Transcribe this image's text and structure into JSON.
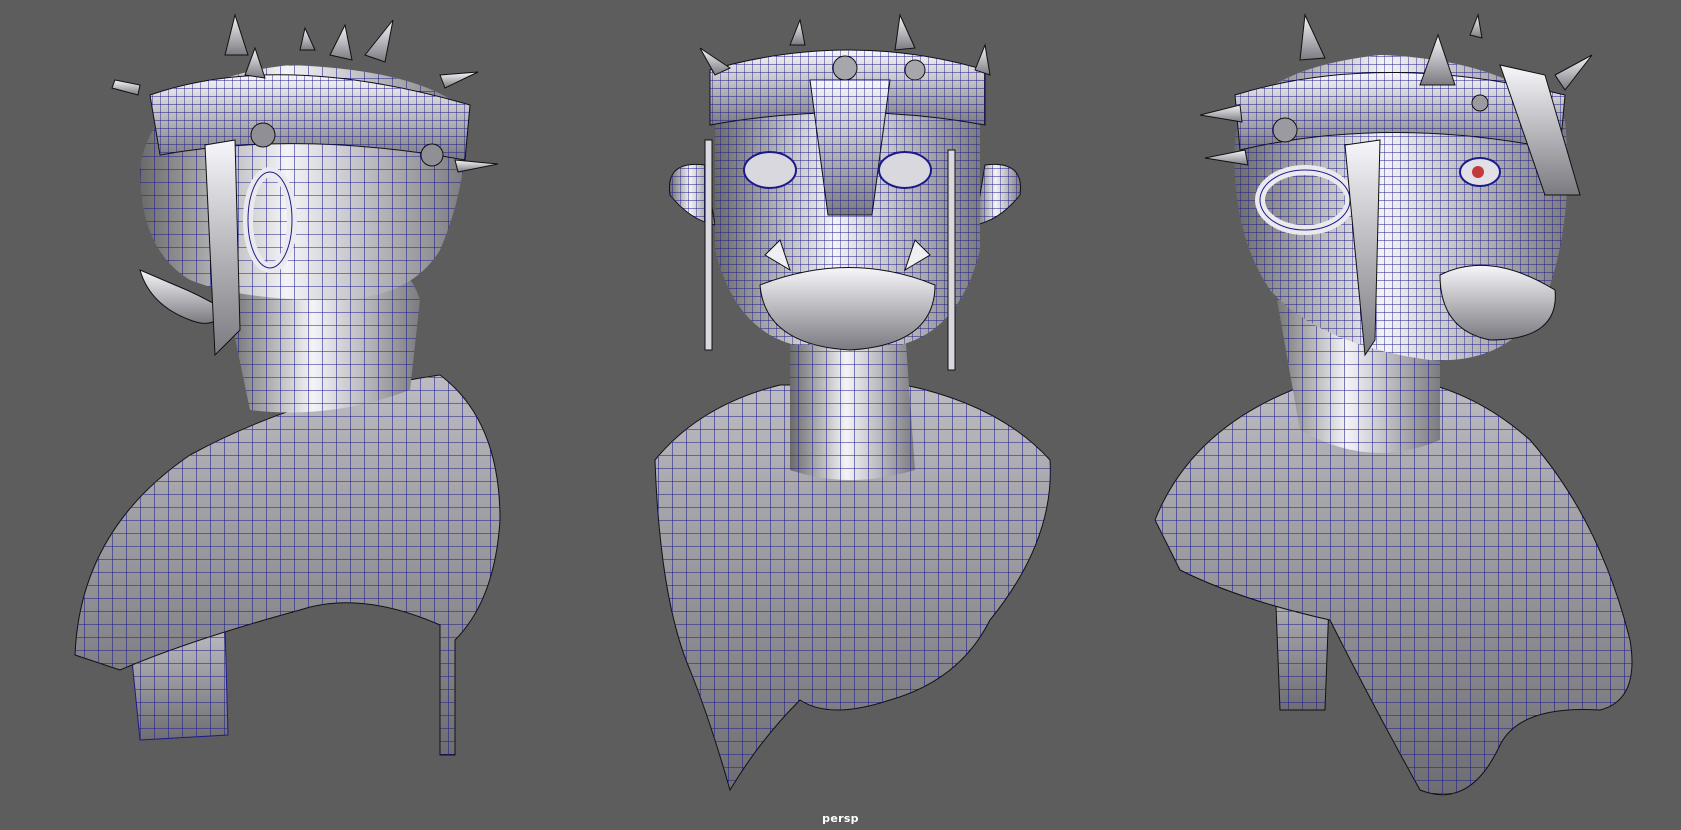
{
  "viewport": {
    "camera_label": "persp",
    "background_color": "#5d5d5d",
    "wire_color": "#1c1a8a",
    "shade_light": "#ffffff",
    "shade_dark": "#1a1a1a",
    "eye_accent": "#c23a3a",
    "views": [
      {
        "id": "back-three-quarter",
        "subject": "orc-bust"
      },
      {
        "id": "front",
        "subject": "orc-bust"
      },
      {
        "id": "side-three-quarter",
        "subject": "orc-bust"
      }
    ]
  }
}
